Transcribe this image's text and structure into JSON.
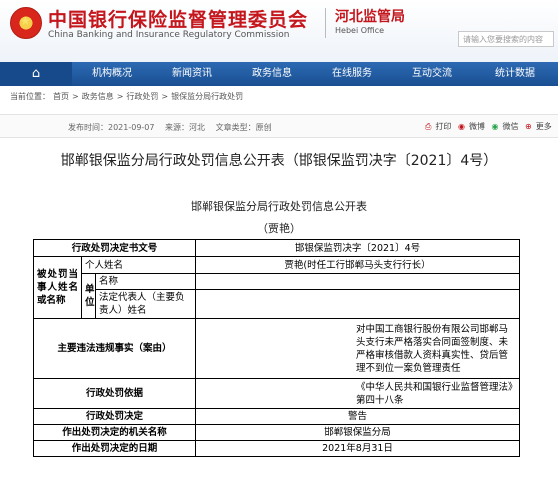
{
  "header": {
    "title_cn": "中国银行保险监督管理委员会",
    "title_en": "China Banking and Insurance Regulatory Commission",
    "branch_cn": "河北监管局",
    "branch_en": "Hebei Office",
    "search_placeholder": "请输入您要搜索的内容"
  },
  "nav": {
    "items": [
      "机构概况",
      "新闻资讯",
      "政务信息",
      "在线服务",
      "互动交流",
      "统计数据"
    ]
  },
  "breadcrumb": {
    "label": "当前位置：",
    "items": [
      "首页",
      "政务信息",
      "行政处罚",
      "银保监分局行政处罚"
    ],
    "sep": ">"
  },
  "meta": {
    "date": "发布时间：2021-09-07",
    "source": "来源：河北",
    "category": "文章类型：原创"
  },
  "tools": {
    "print": "打印",
    "weibo": "微博",
    "wechat": "微信",
    "more": "更多"
  },
  "doc": {
    "title": "邯郸银保监分局行政处罚信息公开表（邯银保监罚决字〔2021〕4号）",
    "subtitle": "邯郸银保监分局行政处罚信息公开表",
    "person": "（贾艳）"
  },
  "table": {
    "doc_no_label": "行政处罚决定书文号",
    "doc_no": "邯银保监罚决字〔2021〕4号",
    "party_label": "被处罚当事人姓名或名称",
    "individual_label": "个人姓名",
    "individual_value": "贾艳(时任工行邯郸马头支行行长）",
    "unit_label": "单位",
    "name_label": "名称",
    "name_value": "",
    "rep_label": "法定代表人（主要负责人）姓名",
    "rep_value": "",
    "violation_label": "主要违法违规事实（案由）",
    "violation_value": "对中国工商银行股份有限公司邯郸马头支行未严格落实合同面签制度、未严格审核借款人资料真实性、贷后管理不到位一案负管理责任",
    "basis_label": "行政处罚依据",
    "basis_value": "《中华人民共和国银行业监督管理法》第四十八条",
    "decision_label": "行政处罚决定",
    "decision_value": "警告",
    "authority_label": "作出处罚决定的机关名称",
    "authority_value": "邯郸银保监分局",
    "date_label": "作出处罚决定的日期",
    "date_value": "2021年8月31日"
  }
}
